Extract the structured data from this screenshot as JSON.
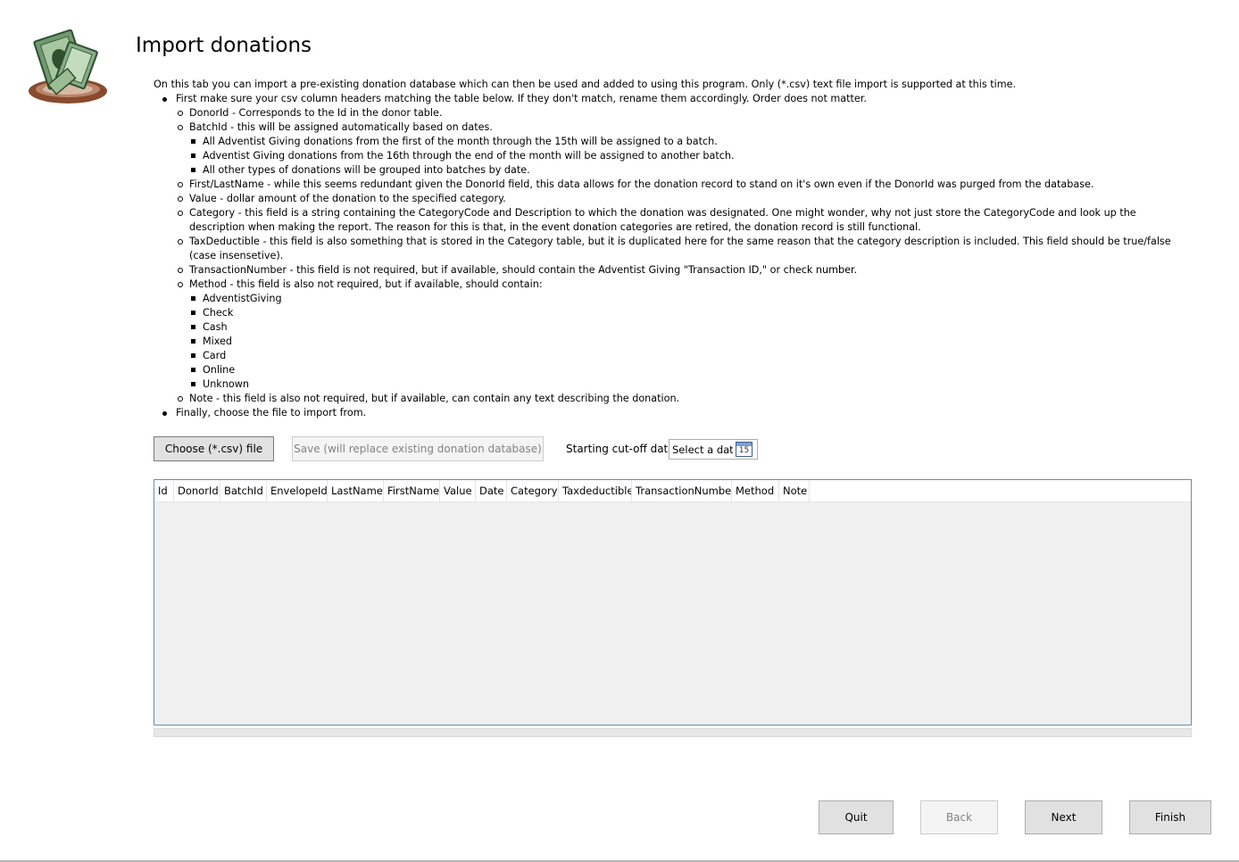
{
  "page": {
    "title": "Import donations",
    "logo_icon": "money-on-plate-icon"
  },
  "instructions": {
    "intro": "On this tab you can import a pre-existing donation database which can then be used and added to using this program. Only (*.csv) text file import is supported at this time.",
    "step1": "First make sure your csv column headers matching the table below. If they don't match, rename them accordingly. Order does not matter.",
    "donorid": "DonorId - Corresponds to the Id in the donor table.",
    "batchid": "BatchId - this will be assigned automatically based on dates.",
    "batch_rules": [
      "All Adventist Giving donations from the first of the month through the 15th will be assigned to a batch.",
      "Adventist Giving donations from the 16th through the end of the month will be assigned to another batch.",
      "All other types of donations will be grouped into batches by date."
    ],
    "name": "First/LastName - while this seems redundant given the DonorId field, this data allows for the donation record to stand on it's own even if the DonorId was purged from the database.",
    "value": "Value - dollar amount of the donation to the specified category.",
    "category": "Category - this field is a string containing the CategoryCode and Description to which the donation was designated. One might wonder, why not just store the CategoryCode and look up the description when making the report. The reason for this is that, in the event donation categories are retired, the donation record is still functional.",
    "taxdeductible": "TaxDeductible - this field is also something that is stored in the Category table, but it is duplicated here for the same reason that the category description is included. This field should be true/false (case insensetive).",
    "transaction": "TransactionNumber - this field is not required, but if available, should contain the Adventist Giving \"Transaction ID,\" or check number.",
    "method": "Method - this field is also not required, but if available, should contain:",
    "methods": [
      "AdventistGiving",
      "Check",
      "Cash",
      "Mixed",
      "Card",
      "Online",
      "Unknown"
    ],
    "note": "Note - this field is also not required, but if available, can contain any text describing the donation.",
    "step2": "Finally, choose the file to import from."
  },
  "controls": {
    "choose_label": "Choose (*.csv) file",
    "save_label": "Save (will replace existing donation database)",
    "cutoff_label": "Starting cut-off date:",
    "date_placeholder": "Select a date",
    "calendar_day": "15",
    "calendar_icon": "calendar-icon"
  },
  "table": {
    "columns": [
      "Id",
      "DonorId",
      "BatchId",
      "EnvelopeId",
      "LastName",
      "FirstName",
      "Value",
      "Date",
      "Category",
      "Taxdeductible",
      "TransactionNumber",
      "Method",
      "Note"
    ]
  },
  "nav": {
    "quit": "Quit",
    "back": "Back",
    "next": "Next",
    "finish": "Finish"
  },
  "colors": {
    "grid_border": "#688caf",
    "grid_body": "#f0f0f0",
    "button": "#e1e1e1",
    "button_disabled_text": "#838383"
  }
}
